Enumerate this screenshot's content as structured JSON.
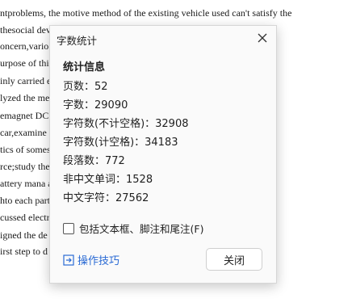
{
  "document": {
    "lines": [
      "ntproblems, the motive method of the existing vehicle used can't satisfy the",
      "thesocial dev                                              tten an",
      "oncern,vario                                              opment.",
      "urpose of thi",
      "inly carried                                              e as",
      "lyzed the me",
      "emagnet DC                                              lectric",
      "car,examine t                                              on",
      "tics of somes                                              to be the",
      "rce;study the                                              ucture of",
      "attery mana                                              a design",
      "hto each part                                              braking",
      "cussed electr                                              coration",
      "igned the de                                              ure, in the",
      "irst step to d"
    ]
  },
  "dialog": {
    "title": "字数统计",
    "section_heading": "统计信息",
    "stats": [
      "页数：52",
      "字数：29090",
      "字符数(不计空格)：32908",
      "字符数(计空格)：34183",
      "段落数：772",
      "非中文单词：1528",
      "中文字符：27562"
    ],
    "include_checkbox_label": "包括文本框、脚注和尾注(F)",
    "include_checkbox_checked": false,
    "tips_label": "操作技巧",
    "close_button_label": "关闭",
    "accent_color": "#2a6ad4",
    "icons": {
      "close": "close-icon",
      "tips": "tips-icon"
    }
  }
}
